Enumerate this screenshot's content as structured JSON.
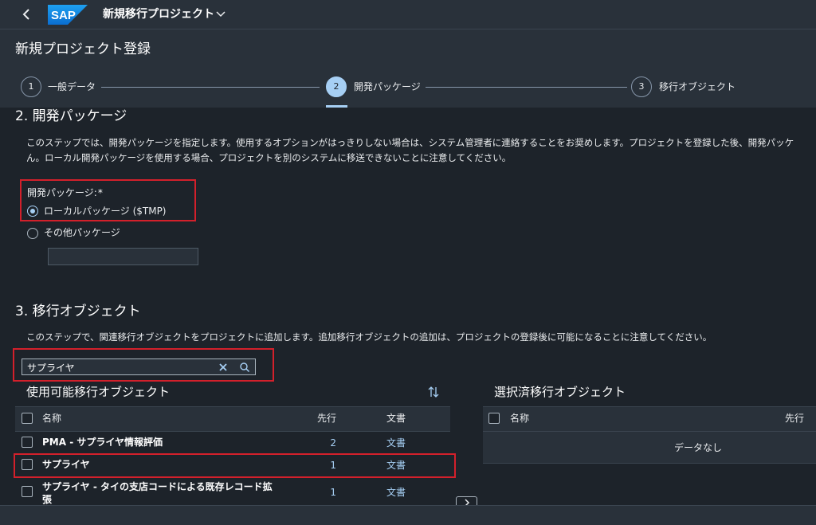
{
  "shell": {
    "back_icon": "‹",
    "logo_text": "SAP",
    "app_title": "新規移行プロジェクト"
  },
  "page": {
    "title": "新規プロジェクト登録"
  },
  "wizard": {
    "steps": [
      {
        "number": "1",
        "label": "一般データ"
      },
      {
        "number": "2",
        "label": "開発パッケージ"
      },
      {
        "number": "3",
        "label": "移行オブジェクト"
      }
    ],
    "active_step": 2
  },
  "section2": {
    "heading": "2. 開発パッケージ",
    "desc_line1": "このステップでは、開発パッケージを指定します。使用するオプションがはっきりしない場合は、システム管理者に連絡することをお奨めします。プロジェクトを登録した後、開発パッケ",
    "desc_line2": "ん。ローカル開発パッケージを使用する場合、プロジェクトを別のシステムに移送できないことに注意してください。",
    "field_label": "開発パッケージ:",
    "required_mark": "*",
    "options": [
      {
        "label": "ローカルパッケージ ($TMP)",
        "selected": true
      },
      {
        "label": "その他パッケージ",
        "selected": false
      }
    ],
    "other_package_value": ""
  },
  "section3": {
    "heading": "3. 移行オブジェクト",
    "desc": "このステップで、関連移行オブジェクトをプロジェクトに追加します。追加移行オブジェクトの追加は、プロジェクトの登録後に可能になることに注意してください。",
    "search_value": "サプライヤ"
  },
  "available": {
    "title": "使用可能移行オブジェクト",
    "columns": {
      "name": "名称",
      "prereq": "先行",
      "doc": "文書"
    },
    "rows": [
      {
        "name": "PMA - サプライヤ情報評価",
        "prereq": "2",
        "doc": "文書"
      },
      {
        "name": "サプライヤ",
        "prereq": "1",
        "doc": "文書"
      },
      {
        "name_line1": "サプライヤ - タイの支店コードによる既存レコード拡",
        "name_line2": "張",
        "prereq": "1",
        "doc": "文書"
      }
    ]
  },
  "selected": {
    "title": "選択済移行オブジェクト",
    "columns": {
      "name": "名称",
      "prereq": "先行"
    },
    "empty_text": "データなし"
  },
  "colors": {
    "accent": "#a6cff4",
    "highlight_red": "#d3202b",
    "background": "#1d232a",
    "header": "#29313a"
  },
  "icons": {
    "sort": "sort-icon",
    "clear": "clear-icon",
    "search": "search-icon",
    "move": "chevron-right-icon"
  }
}
